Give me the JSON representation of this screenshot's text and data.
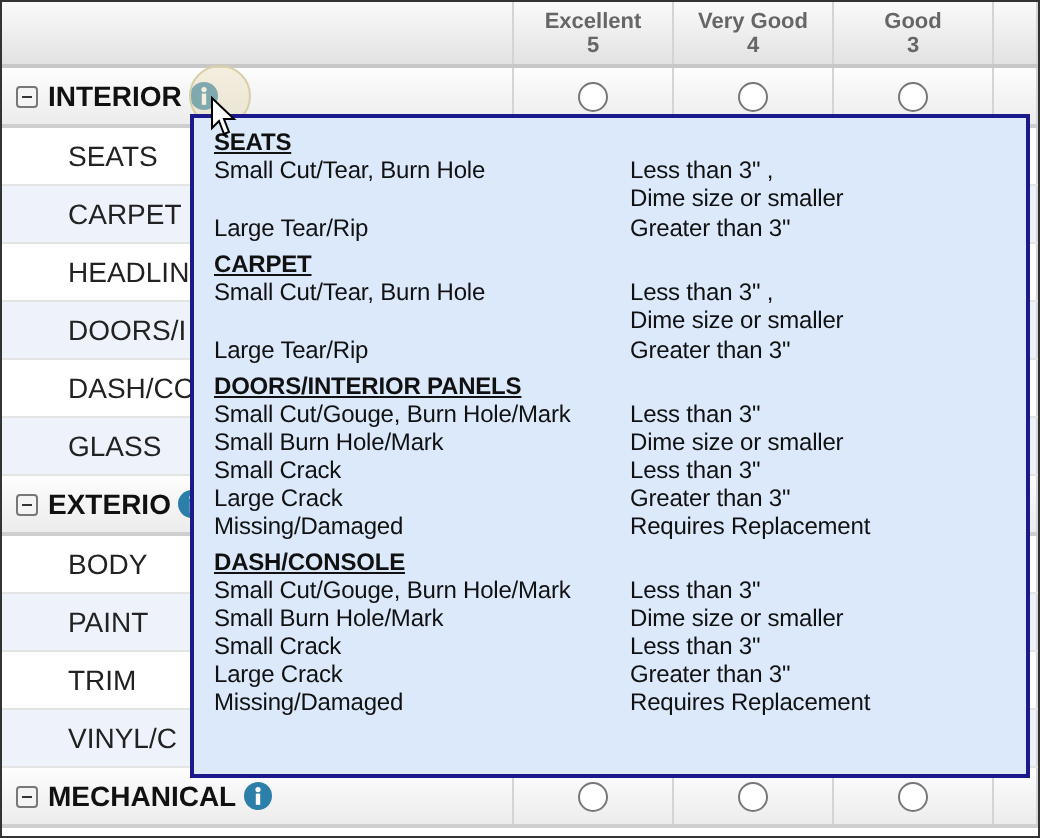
{
  "header": {
    "columns": [
      {
        "label": "Excellent",
        "score": "5"
      },
      {
        "label": "Very Good",
        "score": "4"
      },
      {
        "label": "Good",
        "score": "3"
      }
    ]
  },
  "sections": [
    {
      "title": "INTERIOR",
      "expanded": true,
      "radios": [
        {
          "checked": false
        },
        {
          "checked": false
        },
        {
          "checked": false
        }
      ],
      "items": [
        "SEATS",
        "CARPET",
        "HEADLIN",
        "DOORS/I",
        "DASH/CO",
        "GLASS"
      ]
    },
    {
      "title": "EXTERIO",
      "expanded": true,
      "items": [
        "BODY",
        "PAINT",
        "TRIM",
        "VINYL/C"
      ]
    },
    {
      "title": "MECHANICAL",
      "expanded": true,
      "radios": [
        {
          "checked": false
        },
        {
          "checked": false
        },
        {
          "checked": false
        }
      ]
    }
  ],
  "tooltip": {
    "groups": [
      {
        "title": "SEATS",
        "rows": [
          {
            "defect": "Small Cut/Tear, Burn Hole",
            "limit": [
              "Less than 3\" ,",
              "Dime size or smaller"
            ]
          },
          {
            "defect": "Large Tear/Rip",
            "limit": [
              "Greater than 3\""
            ]
          }
        ]
      },
      {
        "title": "CARPET",
        "rows": [
          {
            "defect": "Small Cut/Tear, Burn Hole",
            "limit": [
              "Less than 3\" ,",
              "Dime size or smaller"
            ]
          },
          {
            "defect": "Large Tear/Rip",
            "limit": [
              "Greater than 3\""
            ]
          }
        ]
      },
      {
        "title": "DOORS/INTERIOR PANELS",
        "rows": [
          {
            "defect": "Small Cut/Gouge, Burn Hole/Mark",
            "limit": [
              "Less than 3\""
            ]
          },
          {
            "defect": "Small Burn Hole/Mark",
            "limit": [
              "Dime size or smaller"
            ]
          },
          {
            "defect": "Small Crack",
            "limit": [
              "Less than 3\""
            ]
          },
          {
            "defect": "Large Crack",
            "limit": [
              "Greater than 3\""
            ]
          },
          {
            "defect": "Missing/Damaged",
            "limit": [
              "Requires Replacement"
            ]
          }
        ]
      },
      {
        "title": "DASH/CONSOLE",
        "rows": [
          {
            "defect": "Small Cut/Gouge, Burn Hole/Mark",
            "limit": [
              "Less than 3\""
            ]
          },
          {
            "defect": "Small Burn Hole/Mark",
            "limit": [
              "Dime size or smaller"
            ]
          },
          {
            "defect": "Small Crack",
            "limit": [
              "Less than 3\""
            ]
          },
          {
            "defect": "Large Crack",
            "limit": [
              "Greater than 3\""
            ]
          },
          {
            "defect": "Missing/Damaged",
            "limit": [
              "Requires Replacement"
            ]
          }
        ]
      }
    ]
  }
}
